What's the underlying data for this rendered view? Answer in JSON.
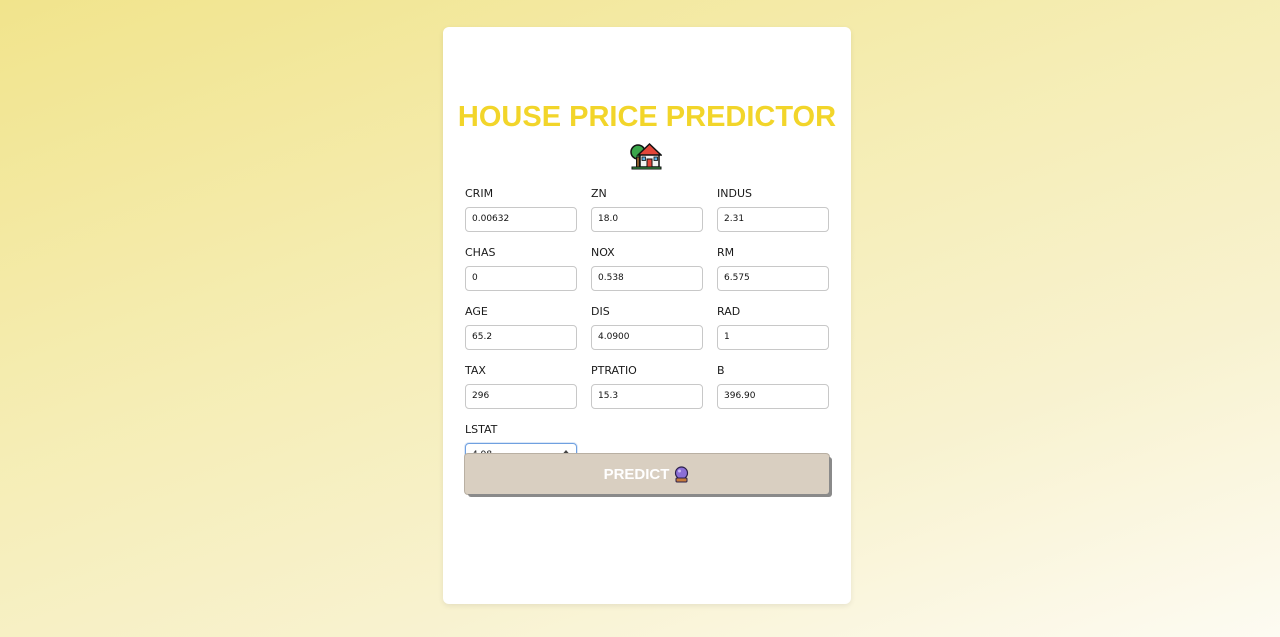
{
  "app": {
    "title": "HOUSE PRICE PREDICTOR",
    "title_icon": "house-with-garden-icon"
  },
  "form": {
    "fields": [
      {
        "label": "CRIM",
        "value": "0.00632"
      },
      {
        "label": "ZN",
        "value": "18.0"
      },
      {
        "label": "INDUS",
        "value": "2.31"
      },
      {
        "label": "CHAS",
        "value": "0"
      },
      {
        "label": "NOX",
        "value": "0.538"
      },
      {
        "label": "RM",
        "value": "6.575"
      },
      {
        "label": "AGE",
        "value": "65.2"
      },
      {
        "label": "DIS",
        "value": "4.0900"
      },
      {
        "label": "RAD",
        "value": "1"
      },
      {
        "label": "TAX",
        "value": "296"
      },
      {
        "label": "PTRATIO",
        "value": "15.3"
      },
      {
        "label": "B",
        "value": "396.90"
      },
      {
        "label": "LSTAT",
        "value": "4.98"
      }
    ],
    "focused_field": "LSTAT"
  },
  "predict_button": {
    "label": "PREDICT",
    "icon": "crystal-ball-icon"
  },
  "colors": {
    "title": "#f2d52a",
    "button_bg": "#d9cfc1",
    "focus_border": "#6fa0e0"
  }
}
